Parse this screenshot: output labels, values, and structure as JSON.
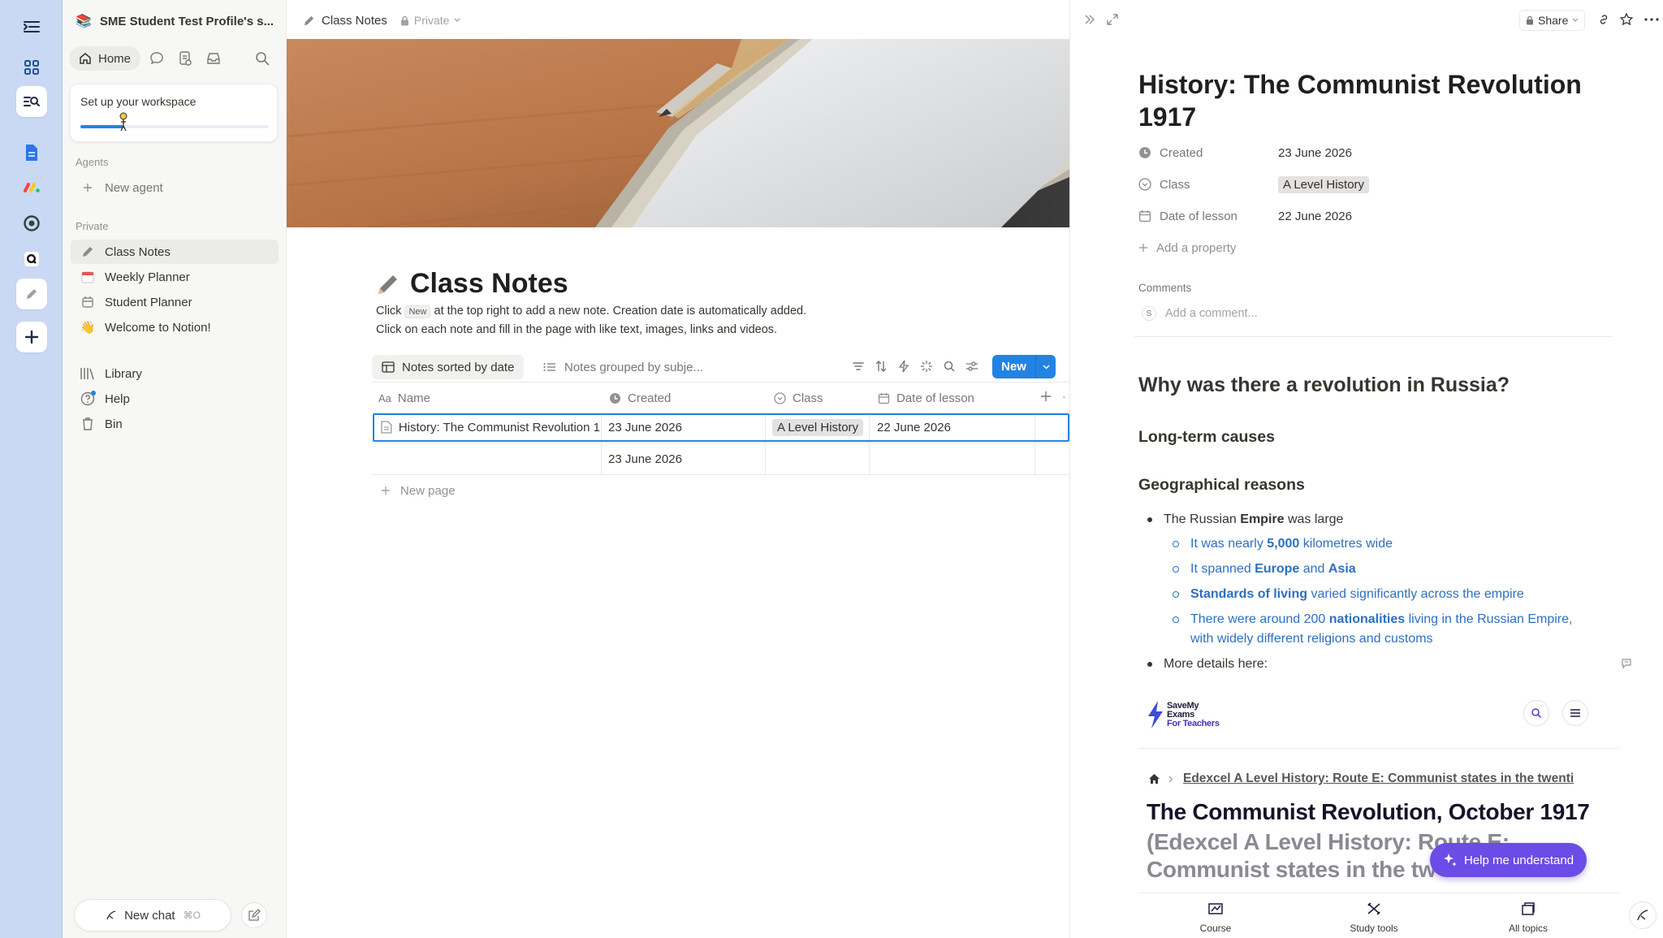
{
  "workspace": {
    "name": "SME Student Test Profile's s..."
  },
  "sidebar": {
    "home_label": "Home",
    "setup": {
      "title": "Set up your workspace",
      "progress": 0.23
    },
    "agents_label": "Agents",
    "new_agent_label": "New agent",
    "private_label": "Private",
    "pages": [
      {
        "label": "Class Notes",
        "icon": "pencil-icon"
      },
      {
        "label": "Weekly Planner",
        "icon": "calendar-page-icon"
      },
      {
        "label": "Student Planner",
        "icon": "calendar-icon"
      },
      {
        "label": "Welcome to Notion!",
        "icon": "wave-emoji"
      }
    ],
    "utilities": [
      {
        "label": "Library",
        "icon": "library-icon"
      },
      {
        "label": "Help",
        "icon": "help-icon"
      },
      {
        "label": "Bin",
        "icon": "bin-icon"
      }
    ],
    "new_chat_label": "New chat",
    "new_chat_shortcut": "⌘O"
  },
  "topbar": {
    "breadcrumb": "Class Notes",
    "privacy": "Private"
  },
  "page": {
    "title": "Class Notes",
    "desc_prefix": "Click",
    "desc_chip": "New",
    "desc_suffix": "at the top right to add a new note. Creation date is automatically added.",
    "desc_line2": "Click on each note and fill in the page with like text, images, links and videos."
  },
  "views": [
    {
      "label": "Notes sorted by date"
    },
    {
      "label": "Notes grouped by subje..."
    }
  ],
  "new_button_label": "New",
  "table": {
    "columns": [
      "Name",
      "Created",
      "Class",
      "Date of lesson"
    ],
    "rows": [
      {
        "name": "History: The Communist Revolution 1",
        "created": "23 June 2026",
        "class": "A Level History",
        "date": "22 June 2026"
      },
      {
        "name": "",
        "created": "23 June 2026",
        "class": "",
        "date": ""
      }
    ],
    "new_page_label": "New page"
  },
  "peek": {
    "share_label": "Share",
    "title": "History: The Communist Revolution 1917",
    "properties": [
      {
        "name": "Created",
        "value": "23 June 2026",
        "icon": "clock-icon"
      },
      {
        "name": "Class",
        "value": "A Level History",
        "icon": "select-icon"
      },
      {
        "name": "Date of lesson",
        "value": "22 June 2026",
        "icon": "calendar-icon"
      }
    ],
    "add_property_label": "Add a property",
    "comments_label": "Comments",
    "comment_avatar": "S",
    "comment_placeholder": "Add a comment...",
    "h1": "Why was there a revolution in Russia?",
    "h2": "Long-term causes",
    "h3": "Geographical reasons",
    "bullet1": {
      "pre": "The Russian ",
      "bold": "Empire",
      "post": " was large"
    },
    "sub": [
      {
        "pre": "It was nearly ",
        "bold": "5,000",
        "post": " kilometres wide"
      },
      {
        "pre": "It spanned ",
        "bold": "Europe",
        "mid": " and ",
        "bold2": "Asia"
      },
      {
        "bold": "Standards of living",
        "post": " varied significantly across the empire"
      },
      {
        "pre": "There were around 200 ",
        "bold": "nationalities",
        "post": " living in the Russian Empire,",
        "line2": "with widely different religions and customs"
      }
    ],
    "bullet2": "More details here:",
    "embed": {
      "logo_line1": "SaveMy",
      "logo_line2": "Exams",
      "logo_line3": "For Teachers",
      "crumb": "Edexcel A Level History: Route E: Communist states in the twenti",
      "title": "The Communist Revolution, October 1917",
      "subtitle_l1": "(Edexcel A Level History: Route E:",
      "subtitle_l2": "Communist states in the tw",
      "help_label": "Help me understand",
      "tabs": [
        "Course",
        "Study tools",
        "All topics"
      ]
    }
  },
  "colors": {
    "accent": "#2383e2",
    "rail": "#c9d9f3",
    "link_blue": "#2e6fbf",
    "embed_purple": "#6b4ce6"
  }
}
